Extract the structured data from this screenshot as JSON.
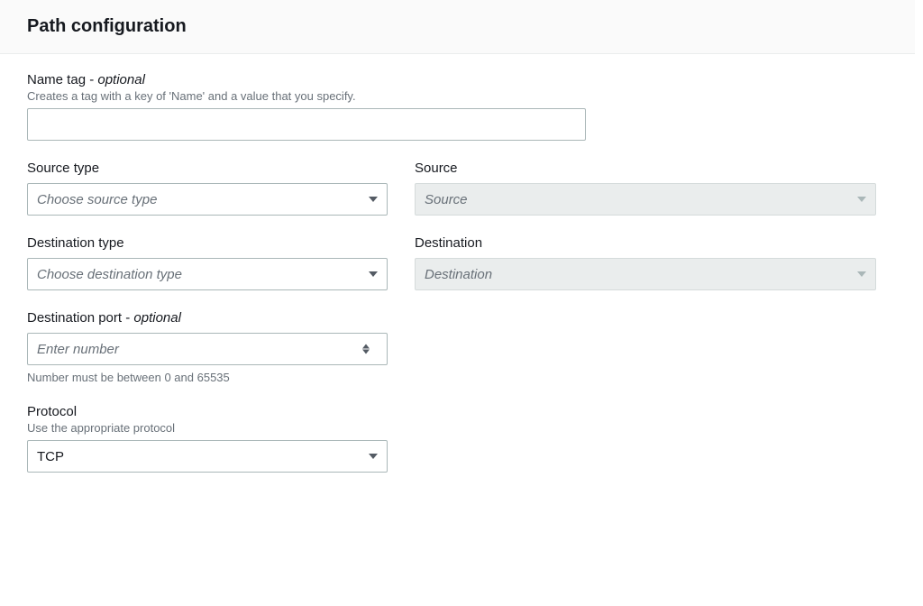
{
  "header": {
    "title": "Path configuration"
  },
  "fields": {
    "nameTag": {
      "label": "Name tag - ",
      "optional": "optional",
      "hint": "Creates a tag with a key of 'Name' and a value that you specify.",
      "value": ""
    },
    "sourceType": {
      "label": "Source type",
      "placeholder": "Choose source type"
    },
    "source": {
      "label": "Source",
      "placeholder": "Source"
    },
    "destinationType": {
      "label": "Destination type",
      "placeholder": "Choose destination type"
    },
    "destination": {
      "label": "Destination",
      "placeholder": "Destination"
    },
    "destinationPort": {
      "label": "Destination port - ",
      "optional": "optional",
      "placeholder": "Enter number",
      "hint": "Number must be between 0 and 65535"
    },
    "protocol": {
      "label": "Protocol",
      "hint": "Use the appropriate protocol",
      "value": "TCP"
    }
  }
}
